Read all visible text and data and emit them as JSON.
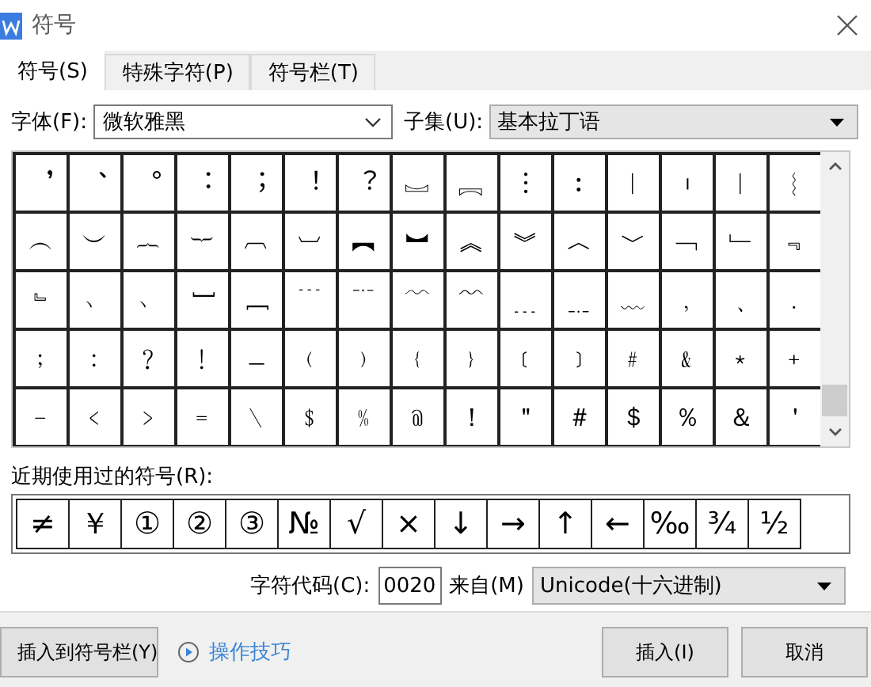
{
  "window": {
    "title": "符号"
  },
  "tabs": [
    {
      "label": "符号(S)",
      "selected": true
    },
    {
      "label": "特殊字符(P)",
      "selected": false
    },
    {
      "label": "符号栏(T)",
      "selected": false
    }
  ],
  "font": {
    "label": "字体(F):",
    "value": "微软雅黑"
  },
  "subset": {
    "label": "子集(U):",
    "value": "基本拉丁语"
  },
  "symbols": [
    [
      "︐",
      "︑",
      "︒",
      "︓",
      "︔",
      "︕",
      "︖",
      "︗",
      "︘",
      "︙",
      "︰",
      "︱",
      "︲",
      "︳",
      "︴"
    ],
    [
      "︵",
      "︶",
      "︷",
      "︸",
      "︹",
      "︺",
      "︻",
      "︼",
      "︽",
      "︾",
      "︿",
      "﹀",
      "﹁",
      "﹂",
      "﹃"
    ],
    [
      "﹄",
      "﹅",
      "﹆",
      "﹇",
      "﹈",
      "﹉",
      "﹊",
      "﹋",
      "﹌",
      "﹍",
      "﹎",
      "﹏",
      "﹐",
      "﹑",
      "﹒"
    ],
    [
      "﹔",
      "﹕",
      "﹖",
      "﹗",
      "﹘",
      "﹙",
      "﹚",
      "﹛",
      "﹜",
      "﹝",
      "﹞",
      "﹟",
      "﹠",
      "﹡",
      "﹢"
    ],
    [
      "﹣",
      "﹤",
      "﹥",
      "﹦",
      "﹨",
      "﹩",
      "﹪",
      "﹫",
      "！",
      "＂",
      "＃",
      "＄",
      "％",
      "＆",
      "＇"
    ]
  ],
  "recent": {
    "label": "近期使用过的符号(R):",
    "symbols": [
      "≠",
      "￥",
      "①",
      "②",
      "③",
      "№",
      "√",
      "×",
      "↓",
      "→",
      "↑",
      "←",
      "‰",
      "¾",
      "½"
    ]
  },
  "char_code": {
    "label": "字符代码(C):",
    "value": "0020"
  },
  "source": {
    "label": "来自(M)",
    "value": "Unicode(十六进制)"
  },
  "buttons": {
    "insert_to_bar": "插入到符号栏(Y)",
    "tips": "操作技巧",
    "insert": "插入(I)",
    "cancel": "取消"
  }
}
